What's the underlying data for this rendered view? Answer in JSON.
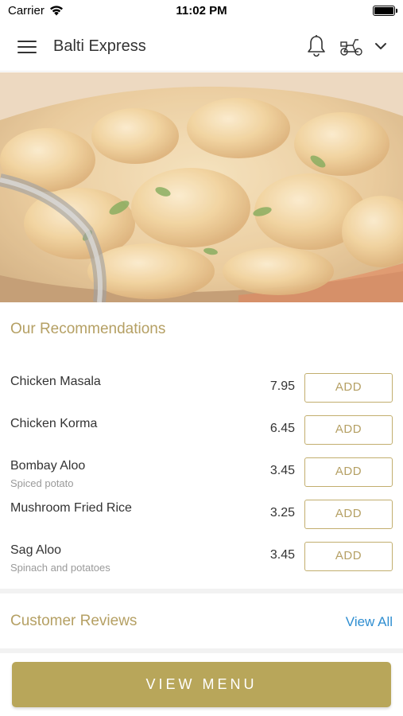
{
  "status_bar": {
    "carrier": "Carrier",
    "time": "11:02 PM"
  },
  "nav": {
    "title": "Balti Express",
    "icons": [
      "menu-icon",
      "bell-icon",
      "scooter-icon",
      "chevron-down-icon"
    ]
  },
  "recommendations": {
    "title": "Our Recommendations",
    "items": [
      {
        "name": "Chicken Masala",
        "description": "",
        "price": "7.95",
        "button": "ADD"
      },
      {
        "name": "Chicken Korma",
        "description": "",
        "price": "6.45",
        "button": "ADD"
      },
      {
        "name": "Bombay Aloo",
        "description": "Spiced potato",
        "price": "3.45",
        "button": "ADD"
      },
      {
        "name": "Mushroom Fried Rice",
        "description": "",
        "price": "3.25",
        "button": "ADD"
      },
      {
        "name": "Sag Aloo",
        "description": "Spinach and potatoes",
        "price": "3.45",
        "button": "ADD"
      }
    ]
  },
  "reviews": {
    "title": "Customer Reviews",
    "view_all": "View All"
  },
  "footer": {
    "view_menu": "VIEW MENU"
  },
  "colors": {
    "accent": "#b5a064",
    "button_fill": "#b8a65a",
    "link": "#2f8ed1"
  }
}
